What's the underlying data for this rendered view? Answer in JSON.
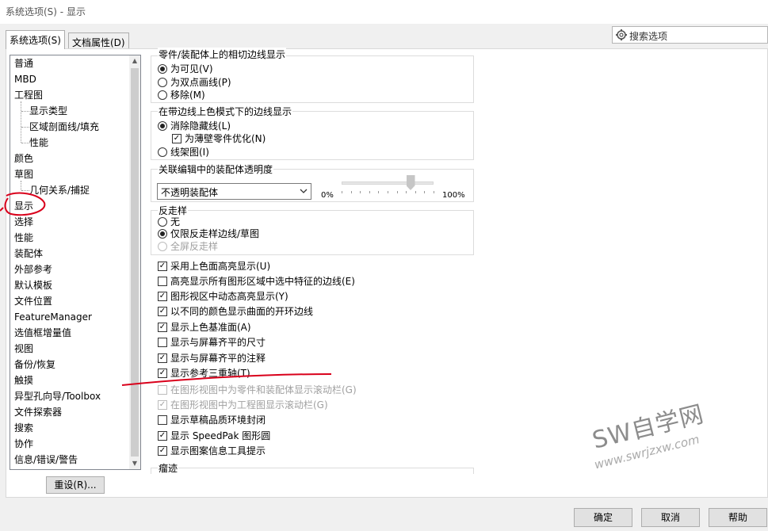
{
  "window": {
    "title": "系统选项(S) - 显示"
  },
  "tabs": [
    {
      "label": "系统选项(S)",
      "active": true
    },
    {
      "label": "文档属性(D)",
      "active": false
    }
  ],
  "search": {
    "placeholder": "搜索选项"
  },
  "tree": {
    "items": [
      {
        "label": "普通",
        "level": 0
      },
      {
        "label": "MBD",
        "level": 0
      },
      {
        "label": "工程图",
        "level": 0
      },
      {
        "label": "显示类型",
        "level": 1
      },
      {
        "label": "区域剖面线/填充",
        "level": 1
      },
      {
        "label": "性能",
        "level": 1
      },
      {
        "label": "颜色",
        "level": 0
      },
      {
        "label": "草图",
        "level": 0
      },
      {
        "label": "几何关系/捕捉",
        "level": 1
      },
      {
        "label": "显示",
        "level": 0,
        "selected": true
      },
      {
        "label": "选择",
        "level": 0
      },
      {
        "label": "性能",
        "level": 0
      },
      {
        "label": "装配体",
        "level": 0
      },
      {
        "label": "外部参考",
        "level": 0
      },
      {
        "label": "默认模板",
        "level": 0
      },
      {
        "label": "文件位置",
        "level": 0
      },
      {
        "label": "FeatureManager",
        "level": 0
      },
      {
        "label": "选值框增量值",
        "level": 0
      },
      {
        "label": "视图",
        "level": 0
      },
      {
        "label": "备份/恢复",
        "level": 0
      },
      {
        "label": "触摸",
        "level": 0
      },
      {
        "label": "异型孔向导/Toolbox",
        "level": 0
      },
      {
        "label": "文件探索器",
        "level": 0
      },
      {
        "label": "搜索",
        "level": 0
      },
      {
        "label": "协作",
        "level": 0
      },
      {
        "label": "信息/错误/警告",
        "level": 0
      }
    ]
  },
  "reset_button": "重设(R)...",
  "groups": {
    "edge_display": {
      "title": "零件/装配体上的相切边线显示",
      "options": [
        "为可见(V)",
        "为双点画线(P)",
        "移除(M)"
      ]
    },
    "shaded_edges": {
      "title": "在带边线上色模式下的边线显示",
      "options": [
        "消除隐藏线(L)",
        "为薄壁零件优化(N)",
        "线架图(I)"
      ]
    },
    "transparency": {
      "title": "关联编辑中的装配体透明度",
      "select_value": "不透明装配体",
      "slider_min": "0%",
      "slider_max": "100%",
      "slider_value": 0.75
    },
    "antialias": {
      "title": "反走样",
      "options": [
        "无",
        "仅限反走样边线/草图",
        "全屏反走样"
      ]
    },
    "last": {
      "title": "瘤迹"
    }
  },
  "checkboxes": [
    {
      "label": "采用上色面高亮显示(U)",
      "checked": true,
      "enabled": true
    },
    {
      "label": "高亮显示所有图形区域中选中特征的边线(E)",
      "checked": false,
      "enabled": true
    },
    {
      "label": "图形视区中动态高亮显示(Y)",
      "checked": true,
      "enabled": true
    },
    {
      "label": "以不同的颜色显示曲面的开环边线",
      "checked": true,
      "enabled": true
    },
    {
      "label": "显示上色基准面(A)",
      "checked": true,
      "enabled": true
    },
    {
      "label": "显示与屏幕齐平的尺寸",
      "checked": false,
      "enabled": true
    },
    {
      "label": "显示与屏幕齐平的注释",
      "checked": true,
      "enabled": true
    },
    {
      "label": "显示参考三重轴(T)",
      "checked": true,
      "enabled": true
    },
    {
      "label": "在图形视图中为零件和装配体显示滚动栏(G)",
      "checked": false,
      "enabled": false
    },
    {
      "label": "在图形视图中为工程图显示滚动栏(G)",
      "checked": true,
      "enabled": false
    },
    {
      "label": "显示草稿品质环境封闭",
      "checked": false,
      "enabled": true
    },
    {
      "label": "显示 SpeedPak 图形圆",
      "checked": true,
      "enabled": true
    },
    {
      "label": "显示图案信息工具提示",
      "checked": true,
      "enabled": true
    }
  ],
  "footer": {
    "ok": "确定",
    "cancel": "取消",
    "help": "帮助"
  },
  "watermark": {
    "main": "SW自学网",
    "sub": "www.swrjzxw.com"
  },
  "colors": {
    "annotation": "#d9001b",
    "border": "#adadad"
  }
}
